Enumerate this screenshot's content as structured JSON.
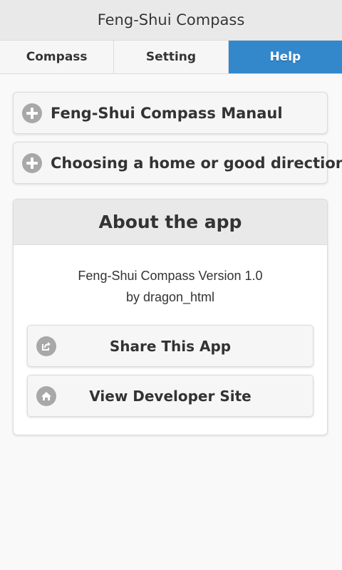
{
  "header": {
    "title": "Feng-Shui Compass"
  },
  "navbar": {
    "tabs": [
      {
        "label": "Compass",
        "active": false
      },
      {
        "label": "Setting",
        "active": false
      },
      {
        "label": "Help",
        "active": true
      }
    ]
  },
  "collapsibles": [
    {
      "label": "Feng-Shui Compass Manaul",
      "icon": "plus-icon"
    },
    {
      "label": "Choosing a home or good direction.",
      "icon": "plus-icon"
    }
  ],
  "about": {
    "title": "About the app",
    "version_line": "Feng-Shui Compass Version 1.0",
    "author_line": "by dragon_html",
    "buttons": [
      {
        "label": "Share This App",
        "icon": "share-icon"
      },
      {
        "label": "View Developer Site",
        "icon": "home-icon"
      }
    ]
  },
  "colors": {
    "accent": "#3388cc",
    "header_bg": "#e9e9e9",
    "icon_gray": "#a8a8a8"
  }
}
